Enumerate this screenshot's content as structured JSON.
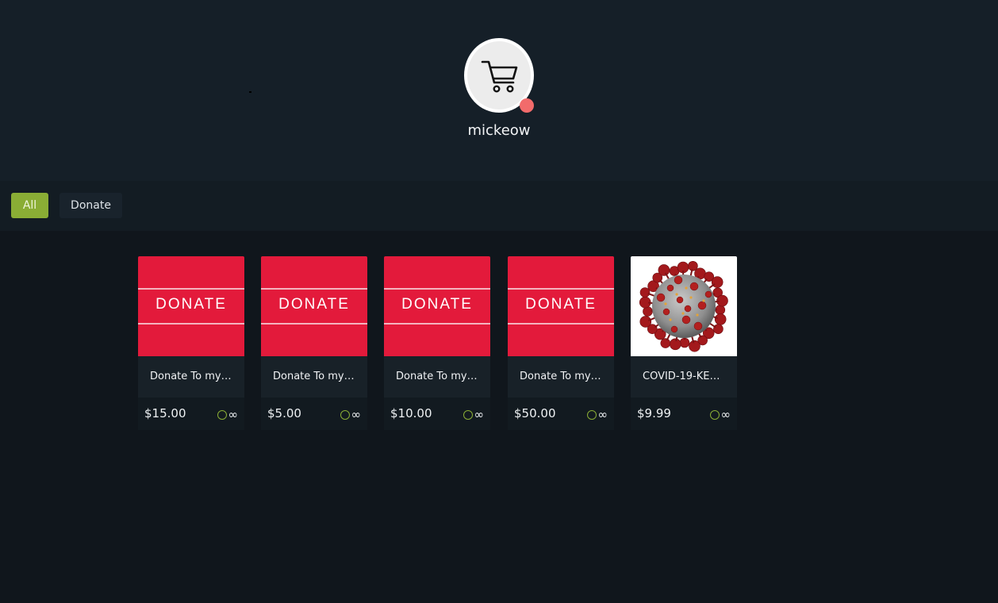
{
  "profile": {
    "username": "mickeow",
    "avatar_icon": "shopping-cart-icon",
    "status_color": "#f26b6b"
  },
  "filters": [
    {
      "label": "All",
      "active": true
    },
    {
      "label": "Donate",
      "active": false
    }
  ],
  "accent_color": "#8aad35",
  "products": [
    {
      "name": "Donate To my ...",
      "price": "$15.00",
      "stock": "∞",
      "image_text": "DONATE"
    },
    {
      "name": "Donate To my ...",
      "price": "$5.00",
      "stock": "∞",
      "image_text": "DONATE"
    },
    {
      "name": "Donate To my ...",
      "price": "$10.00",
      "stock": "∞",
      "image_text": "DONATE"
    },
    {
      "name": "Donate To my ...",
      "price": "$50.00",
      "stock": "∞",
      "image_text": "DONATE"
    },
    {
      "name": "COVID-19-KEN...",
      "price": "$9.99",
      "stock": "∞",
      "image_icon": "coronavirus-image"
    }
  ]
}
